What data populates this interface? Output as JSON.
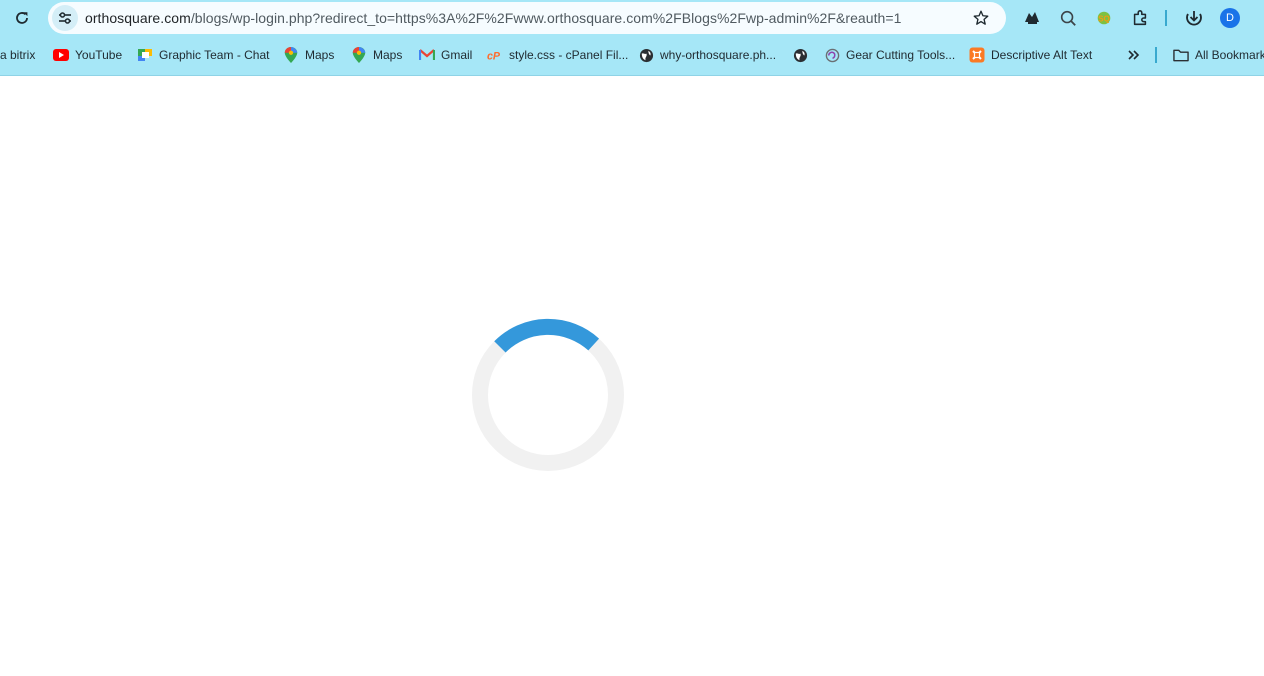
{
  "browser": {
    "url_host": "orthosquare.com",
    "url_rest": "/blogs/wp-login.php?redirect_to=https%3A%2F%2Fwww.orthosquare.com%2FBlogs%2Fwp-admin%2F&reauth=1",
    "profile_initial": "D"
  },
  "bookmarks": {
    "items": [
      {
        "label": "a bitrix",
        "icon": "bitrix-icon"
      },
      {
        "label": "YouTube",
        "icon": "youtube-icon"
      },
      {
        "label": "Graphic Team - Chat",
        "icon": "google-chat-icon"
      },
      {
        "label": "Maps",
        "icon": "google-maps-icon"
      },
      {
        "label": "Maps",
        "icon": "google-maps-icon"
      },
      {
        "label": "Gmail",
        "icon": "gmail-icon"
      },
      {
        "label": "style.css - cPanel Fil...",
        "icon": "cpanel-icon"
      },
      {
        "label": "why-orthosquare.ph...",
        "icon": "globe-icon"
      },
      {
        "label": "",
        "icon": "globe-icon"
      },
      {
        "label": "Gear Cutting Tools...",
        "icon": "gear-site-icon"
      },
      {
        "label": "Descriptive Alt Text",
        "icon": "xampp-icon"
      }
    ],
    "all_bookmarks_label": "All Bookmarks"
  },
  "colors": {
    "chrome_bg": "#a6e7f7",
    "spinner_track": "#f1f1f1",
    "spinner_arc": "#3498db"
  }
}
